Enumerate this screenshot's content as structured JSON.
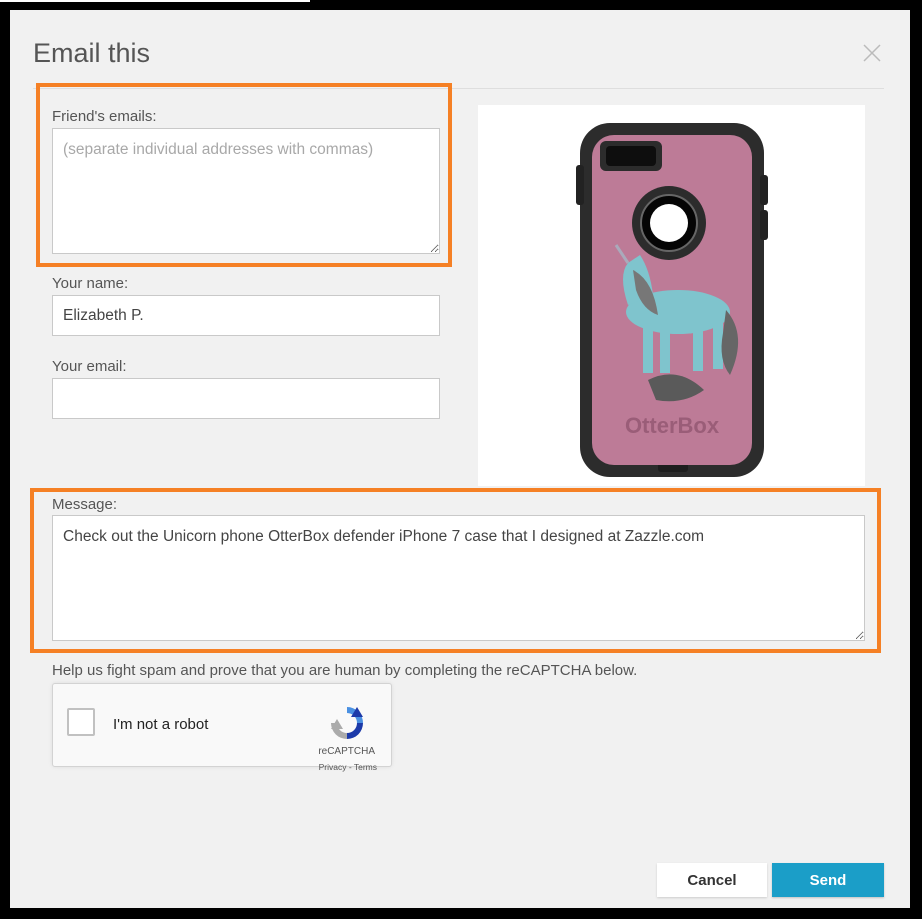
{
  "dialog": {
    "title": "Email this"
  },
  "form": {
    "friends_emails": {
      "label": "Friend's emails:",
      "value": "",
      "placeholder": "(separate individual addresses with commas)"
    },
    "your_name": {
      "label": "Your name:",
      "value": "Elizabeth P."
    },
    "your_email": {
      "label": "Your email:",
      "value": ""
    },
    "message": {
      "label": "Message:",
      "value": "Check out the Unicorn phone OtterBox defender iPhone 7 case that I designed at Zazzle.com"
    }
  },
  "product": {
    "brand_mark": "OtterBox"
  },
  "captcha": {
    "help_text": "Help us fight spam and prove that you are human by completing the reCAPTCHA below.",
    "checkbox_label": "I'm not a robot",
    "brand": "reCAPTCHA",
    "links": "Privacy - Terms"
  },
  "buttons": {
    "cancel": "Cancel",
    "send": "Send"
  },
  "colors": {
    "highlight": "#f58025",
    "send_button": "#1b9ec8",
    "case_pink": "#bd7b97",
    "unicorn_blue": "#7fc4cd"
  }
}
